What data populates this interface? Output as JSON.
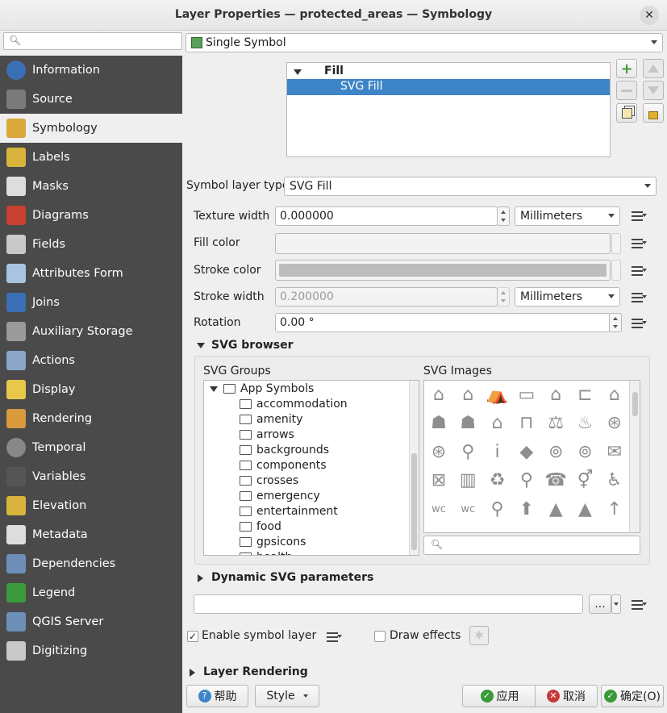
{
  "window": {
    "title": "Layer Properties — protected_areas — Symbology",
    "close_glyph": "✕"
  },
  "sidebar": {
    "search_placeholder": "",
    "items": [
      {
        "label": "Information",
        "icon": "info-icon"
      },
      {
        "label": "Source",
        "icon": "wrench-icon"
      },
      {
        "label": "Symbology",
        "icon": "paintbrush-icon"
      },
      {
        "label": "Labels",
        "icon": "abc-label-icon"
      },
      {
        "label": "Masks",
        "icon": "abc-mask-icon"
      },
      {
        "label": "Diagrams",
        "icon": "diagrams-icon"
      },
      {
        "label": "Fields",
        "icon": "fields-icon"
      },
      {
        "label": "Attributes Form",
        "icon": "form-icon"
      },
      {
        "label": "Joins",
        "icon": "joins-icon"
      },
      {
        "label": "Auxiliary Storage",
        "icon": "database-icon"
      },
      {
        "label": "Actions",
        "icon": "gear-icon"
      },
      {
        "label": "Display",
        "icon": "speech-bubble-icon"
      },
      {
        "label": "Rendering",
        "icon": "brush-icon"
      },
      {
        "label": "Temporal",
        "icon": "clock-icon"
      },
      {
        "label": "Variables",
        "icon": "variables-icon"
      },
      {
        "label": "Elevation",
        "icon": "elevation-icon"
      },
      {
        "label": "Metadata",
        "icon": "metadata-icon"
      },
      {
        "label": "Dependencies",
        "icon": "dependencies-icon"
      },
      {
        "label": "Legend",
        "icon": "legend-icon"
      },
      {
        "label": "QGIS Server",
        "icon": "server-icon"
      },
      {
        "label": "Digitizing",
        "icon": "digitizing-icon"
      }
    ],
    "active_index": 2
  },
  "renderer": {
    "selected": "Single Symbol"
  },
  "symbol_tree": {
    "root": "Fill",
    "child": "SVG Fill"
  },
  "symbol_layer_type": {
    "label": "Symbol layer type",
    "value": "SVG Fill"
  },
  "texture_width": {
    "label": "Texture width",
    "value": "0.000000",
    "unit": "Millimeters"
  },
  "fill_color": {
    "label": "Fill color"
  },
  "stroke_color": {
    "label": "Stroke color",
    "swatch": "#bdbdbd"
  },
  "stroke_width": {
    "label": "Stroke width",
    "value": "0.200000",
    "unit": "Millimeters"
  },
  "rotation": {
    "label": "Rotation",
    "value": "0.00 °"
  },
  "svg_browser": {
    "title": "SVG browser",
    "groups_label": "SVG Groups",
    "images_label": "SVG Images",
    "groups_root": "App Symbols",
    "groups": [
      "accommodation",
      "amenity",
      "arrows",
      "backgrounds",
      "components",
      "crosses",
      "emergency",
      "entertainment",
      "food",
      "gpsicons",
      "health"
    ],
    "images": [
      "⌂",
      "⌂",
      "⛺",
      "▭",
      "⌂",
      "⊏",
      "⌂",
      "☗",
      "☗",
      "⌂",
      "⊓",
      "⚖",
      "♨",
      "⊛",
      "⊛",
      "⚲",
      "i",
      "◆",
      "⊚",
      "⊚",
      "✉",
      "⊠",
      "▥",
      "♻",
      "⚲",
      "☎",
      "⚥",
      "♿",
      "wc",
      "wc",
      "⚲",
      "⬆",
      "▲",
      "▲",
      "↑"
    ]
  },
  "dynamic_svg": {
    "title": "Dynamic SVG parameters",
    "path_value": "",
    "browse_label": "..."
  },
  "enable_symbol_layer": {
    "label": "Enable symbol layer",
    "checked": true
  },
  "draw_effects": {
    "label": "Draw effects",
    "checked": false
  },
  "layer_rendering": {
    "title": "Layer Rendering"
  },
  "footer": {
    "help_label": "帮助",
    "style_label": "Style",
    "apply_label": "应用",
    "cancel_label": "取消",
    "ok_label": "确定(O)"
  },
  "colors": {
    "selection": "#3d85c6",
    "sidebar_bg": "#4a4a4a"
  }
}
